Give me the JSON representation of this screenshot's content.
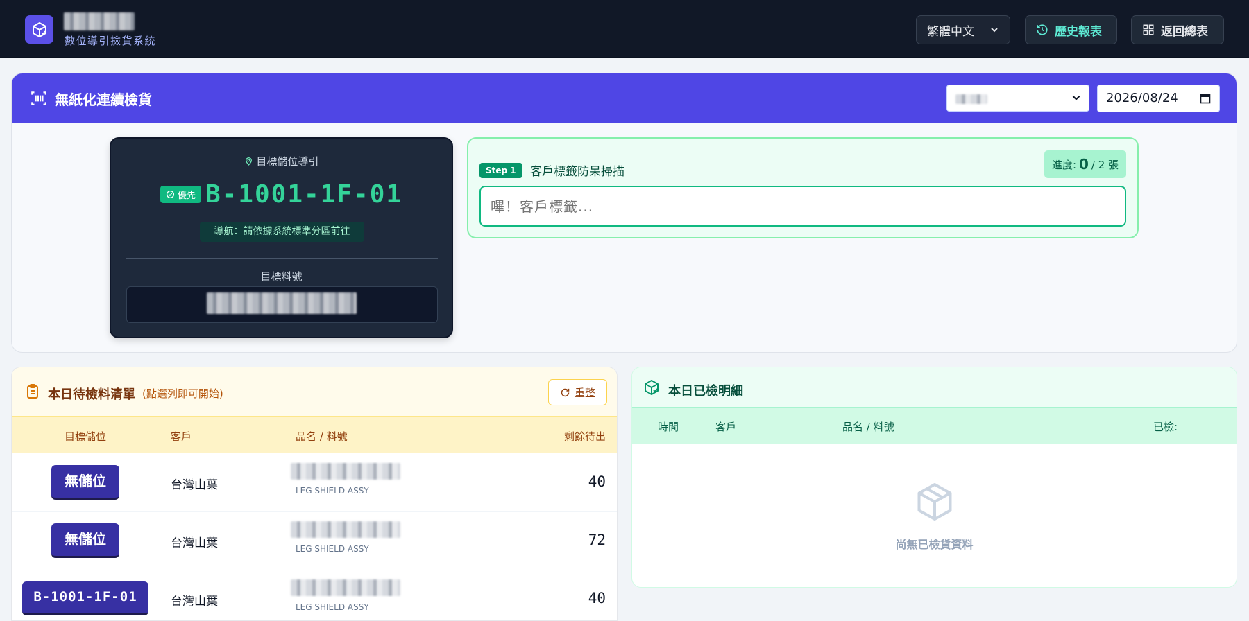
{
  "header": {
    "system_subtitle": "數位導引撿貨系統",
    "language_selected": "繁體中文",
    "history_label": "歷史報表",
    "return_label": "返回總表"
  },
  "panel": {
    "title": "無紙化連續檢貨",
    "date_value": "2026/08/24"
  },
  "guide": {
    "label": "目標儲位導引",
    "priority_badge": "優先",
    "location_code": "B-1001-1F-01",
    "navigation_hint": "導航：請依據系統標準分區前往",
    "part_label": "目標料號"
  },
  "scan": {
    "step_badge": "Step 1",
    "title": "客戶標籤防呆掃描",
    "progress_prefix": "進度:",
    "progress_done": "0",
    "progress_total": "/ 2 張",
    "input_placeholder": "嗶！客戶標籤..."
  },
  "pending": {
    "title": "本日待檢料清單",
    "hint": "(點選列即可開始)",
    "reset_label": "重整",
    "columns": [
      "目標儲位",
      "客戶",
      "品名 / 料號",
      "剩餘待出"
    ],
    "rows": [
      {
        "location": "無儲位",
        "customer": "台灣山葉",
        "desc": "LEG SHIELD ASSY",
        "qty": "40"
      },
      {
        "location": "無儲位",
        "customer": "台灣山葉",
        "desc": "LEG SHIELD ASSY",
        "qty": "72"
      },
      {
        "location": "B-1001-1F-01",
        "customer": "台灣山葉",
        "desc": "LEG SHIELD ASSY",
        "qty": "40"
      }
    ]
  },
  "done": {
    "title": "本日已檢明細",
    "columns": [
      "時間",
      "客戶",
      "品名 / 料號",
      "已檢:"
    ],
    "empty_text": "尚無已檢貨資料"
  },
  "colors": {
    "nav_bg": "#111827",
    "accent": "#4f46e5",
    "success": "#10b981",
    "warning_bg": "#fffbeb"
  }
}
